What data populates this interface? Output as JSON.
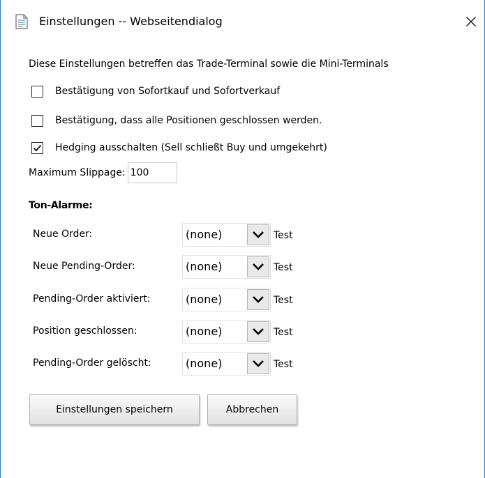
{
  "window": {
    "title": "Einstellungen -- Webseitendialog"
  },
  "intro": "Diese Einstellungen betreffen das Trade-Terminal sowie die Mini-Terminals",
  "options": [
    {
      "label": "Bestätigung von Sofortkauf und Sofortverkauf",
      "checked": false
    },
    {
      "label": "Bestätigung, dass alle Positionen geschlossen werden.",
      "checked": false
    },
    {
      "label": "Hedging ausschalten (Sell schließt Buy und umgekehrt)",
      "checked": true
    }
  ],
  "slippage": {
    "label": "Maximum Slippage:",
    "value": "100"
  },
  "sound_alarms": {
    "heading": "Ton-Alarme:",
    "rows": [
      {
        "label": "Neue Order:",
        "selected": "(none)",
        "test": "Test"
      },
      {
        "label": "Neue Pending-Order:",
        "selected": "(none)",
        "test": "Test"
      },
      {
        "label": "Pending-Order aktiviert:",
        "selected": "(none)",
        "test": "Test"
      },
      {
        "label": "Position geschlossen:",
        "selected": "(none)",
        "test": "Test"
      },
      {
        "label": "Pending-Order gelöscht:",
        "selected": "(none)",
        "test": "Test"
      }
    ]
  },
  "buttons": {
    "save": "Einstellungen speichern",
    "cancel": "Abbrechen"
  },
  "icons": {
    "title": "document-icon",
    "close": "close-icon",
    "dropdown": "chevron-down-icon",
    "check": "check-icon"
  },
  "colors": {
    "window_border": "#2a7ad0",
    "button_border": "#b3b3b3",
    "dropdown_button_bg": "#e9e9e9"
  }
}
